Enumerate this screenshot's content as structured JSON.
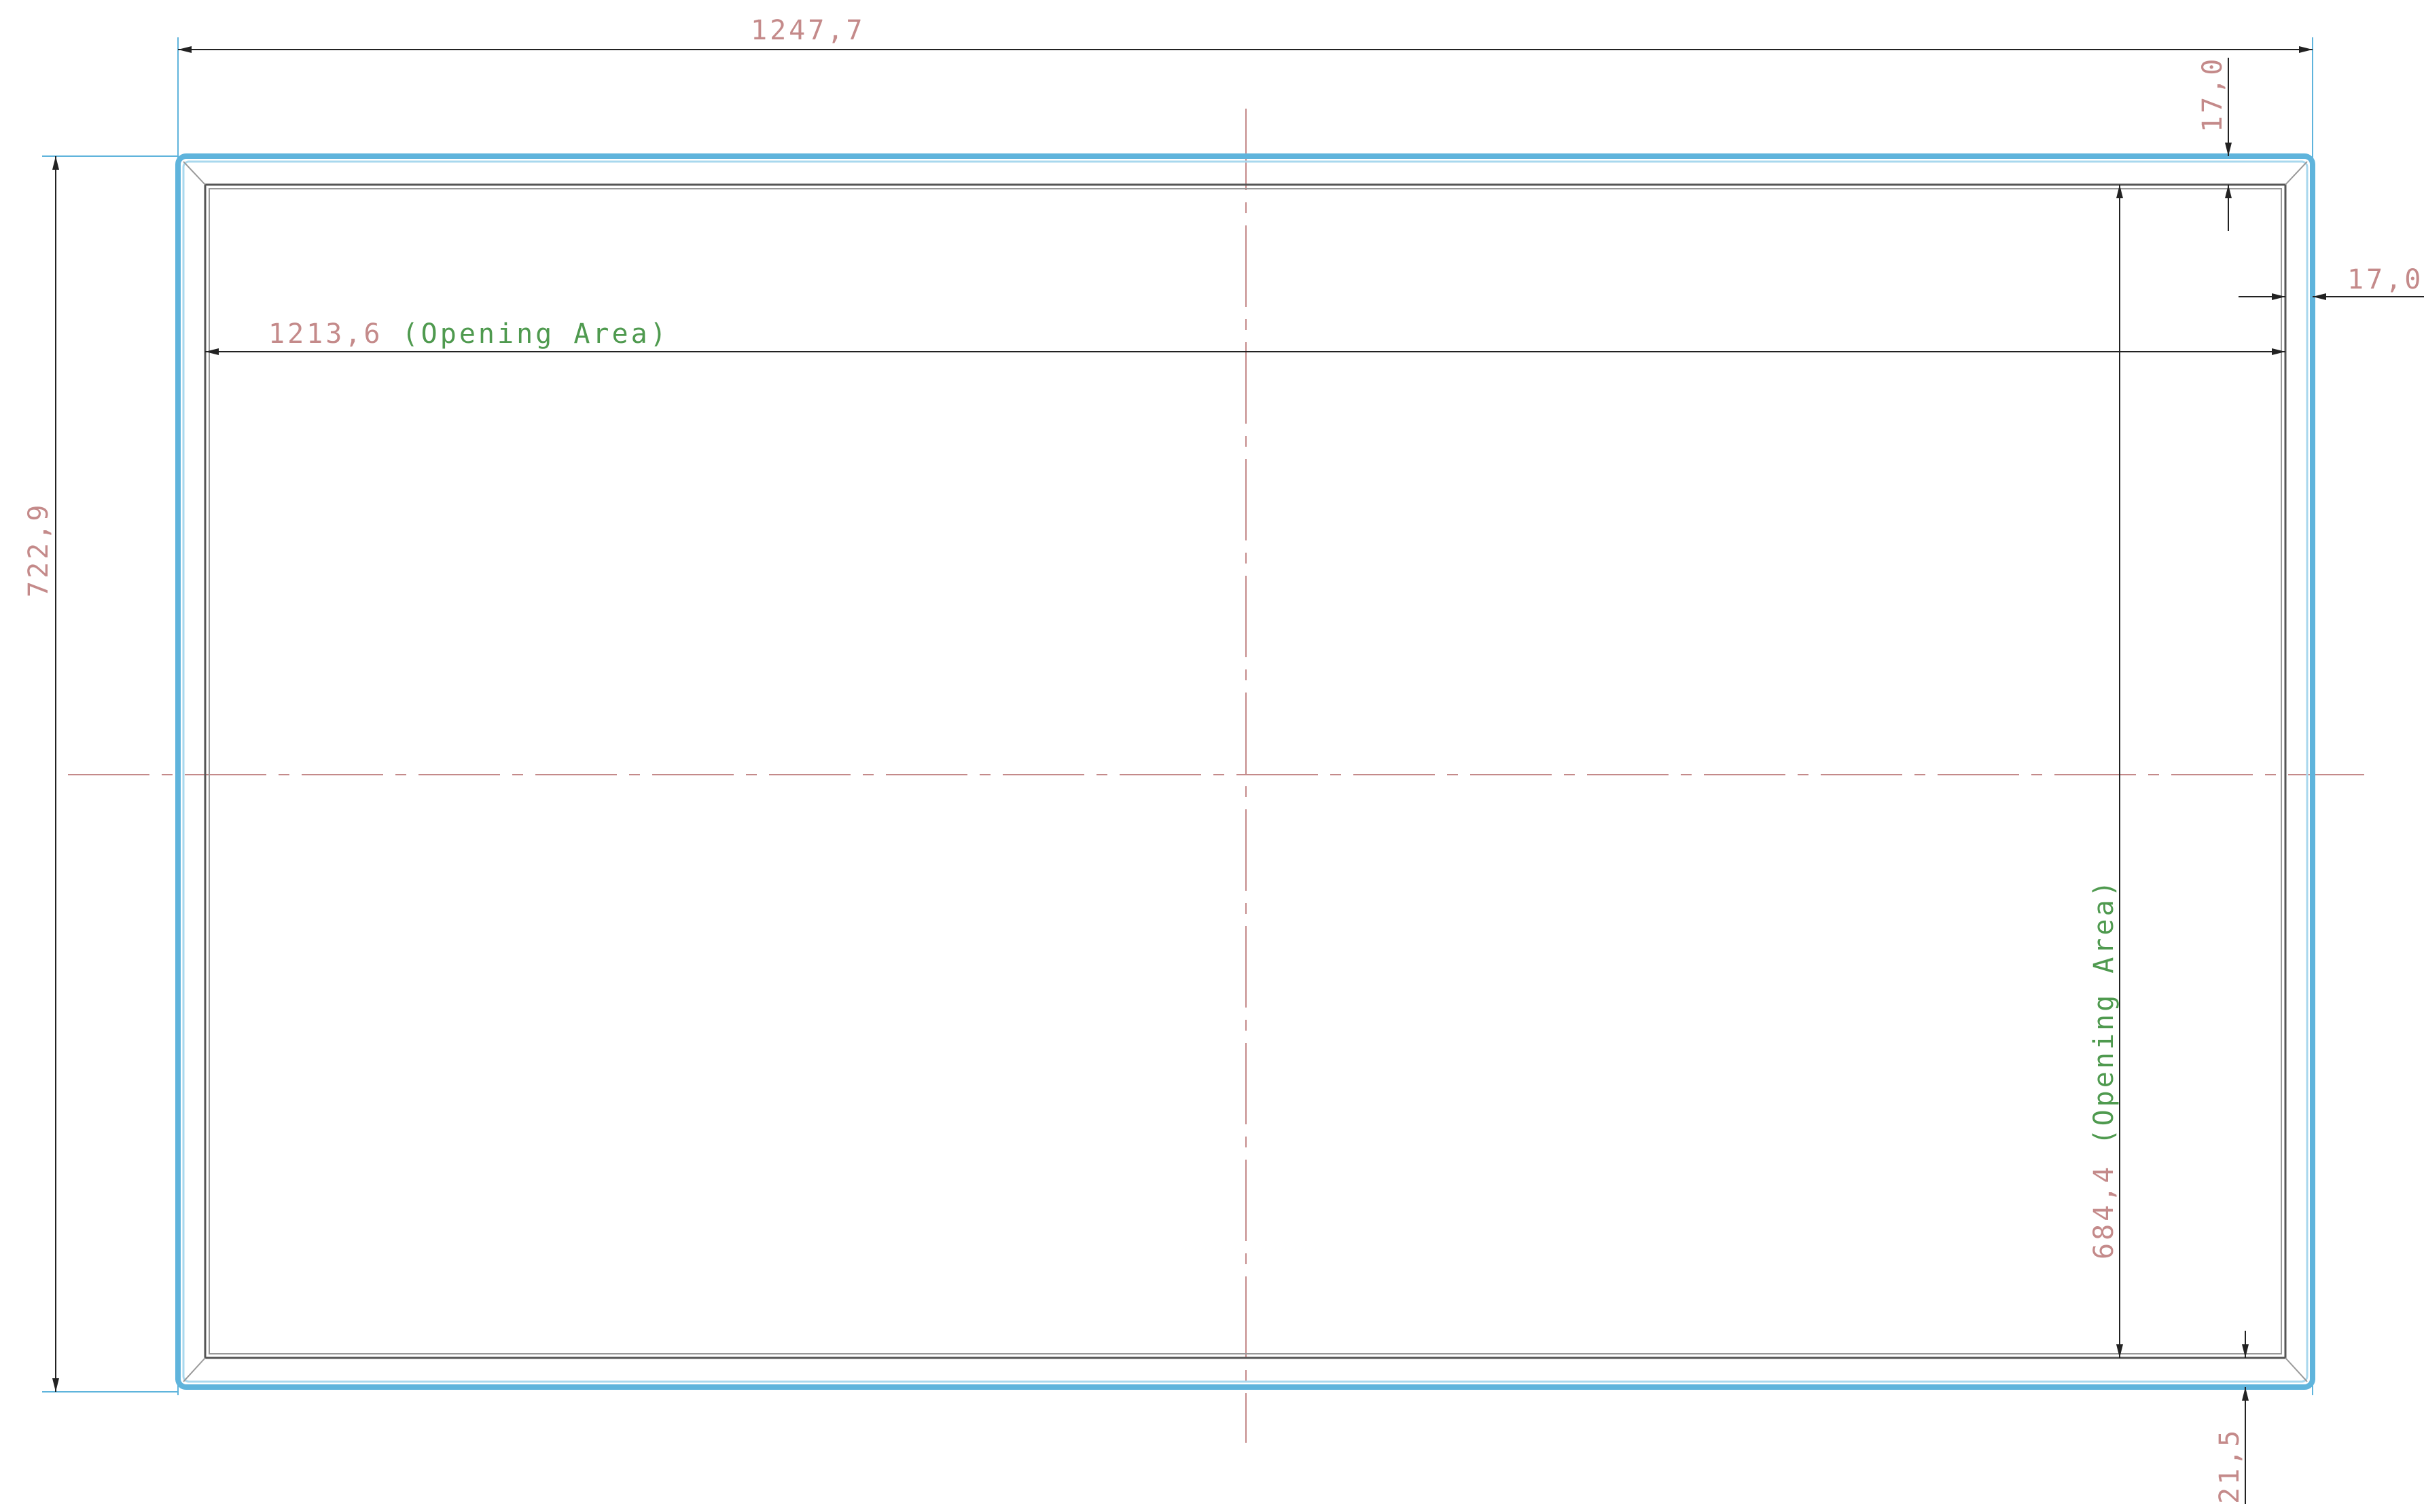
{
  "drawing": {
    "overall_width_label": "1247,7",
    "overall_height_label": "722,9",
    "opening_width_label": "1213,6 (Opening Area)",
    "opening_width_value": "1213,6",
    "opening_width_suffix": "(Opening Area)",
    "opening_height_value": "684,4",
    "opening_height_suffix": "(Opening Area)",
    "top_border_label": "17,0",
    "right_border_label": "17,0",
    "bottom_border_label": "21,5"
  },
  "colors": {
    "outline_blue": "#5fb4dc",
    "dimension_line": "#333333",
    "centerline": "#c48a8a",
    "dimension_text_pink": "#c48a8a",
    "dimension_text_green": "#4f9a4f"
  }
}
